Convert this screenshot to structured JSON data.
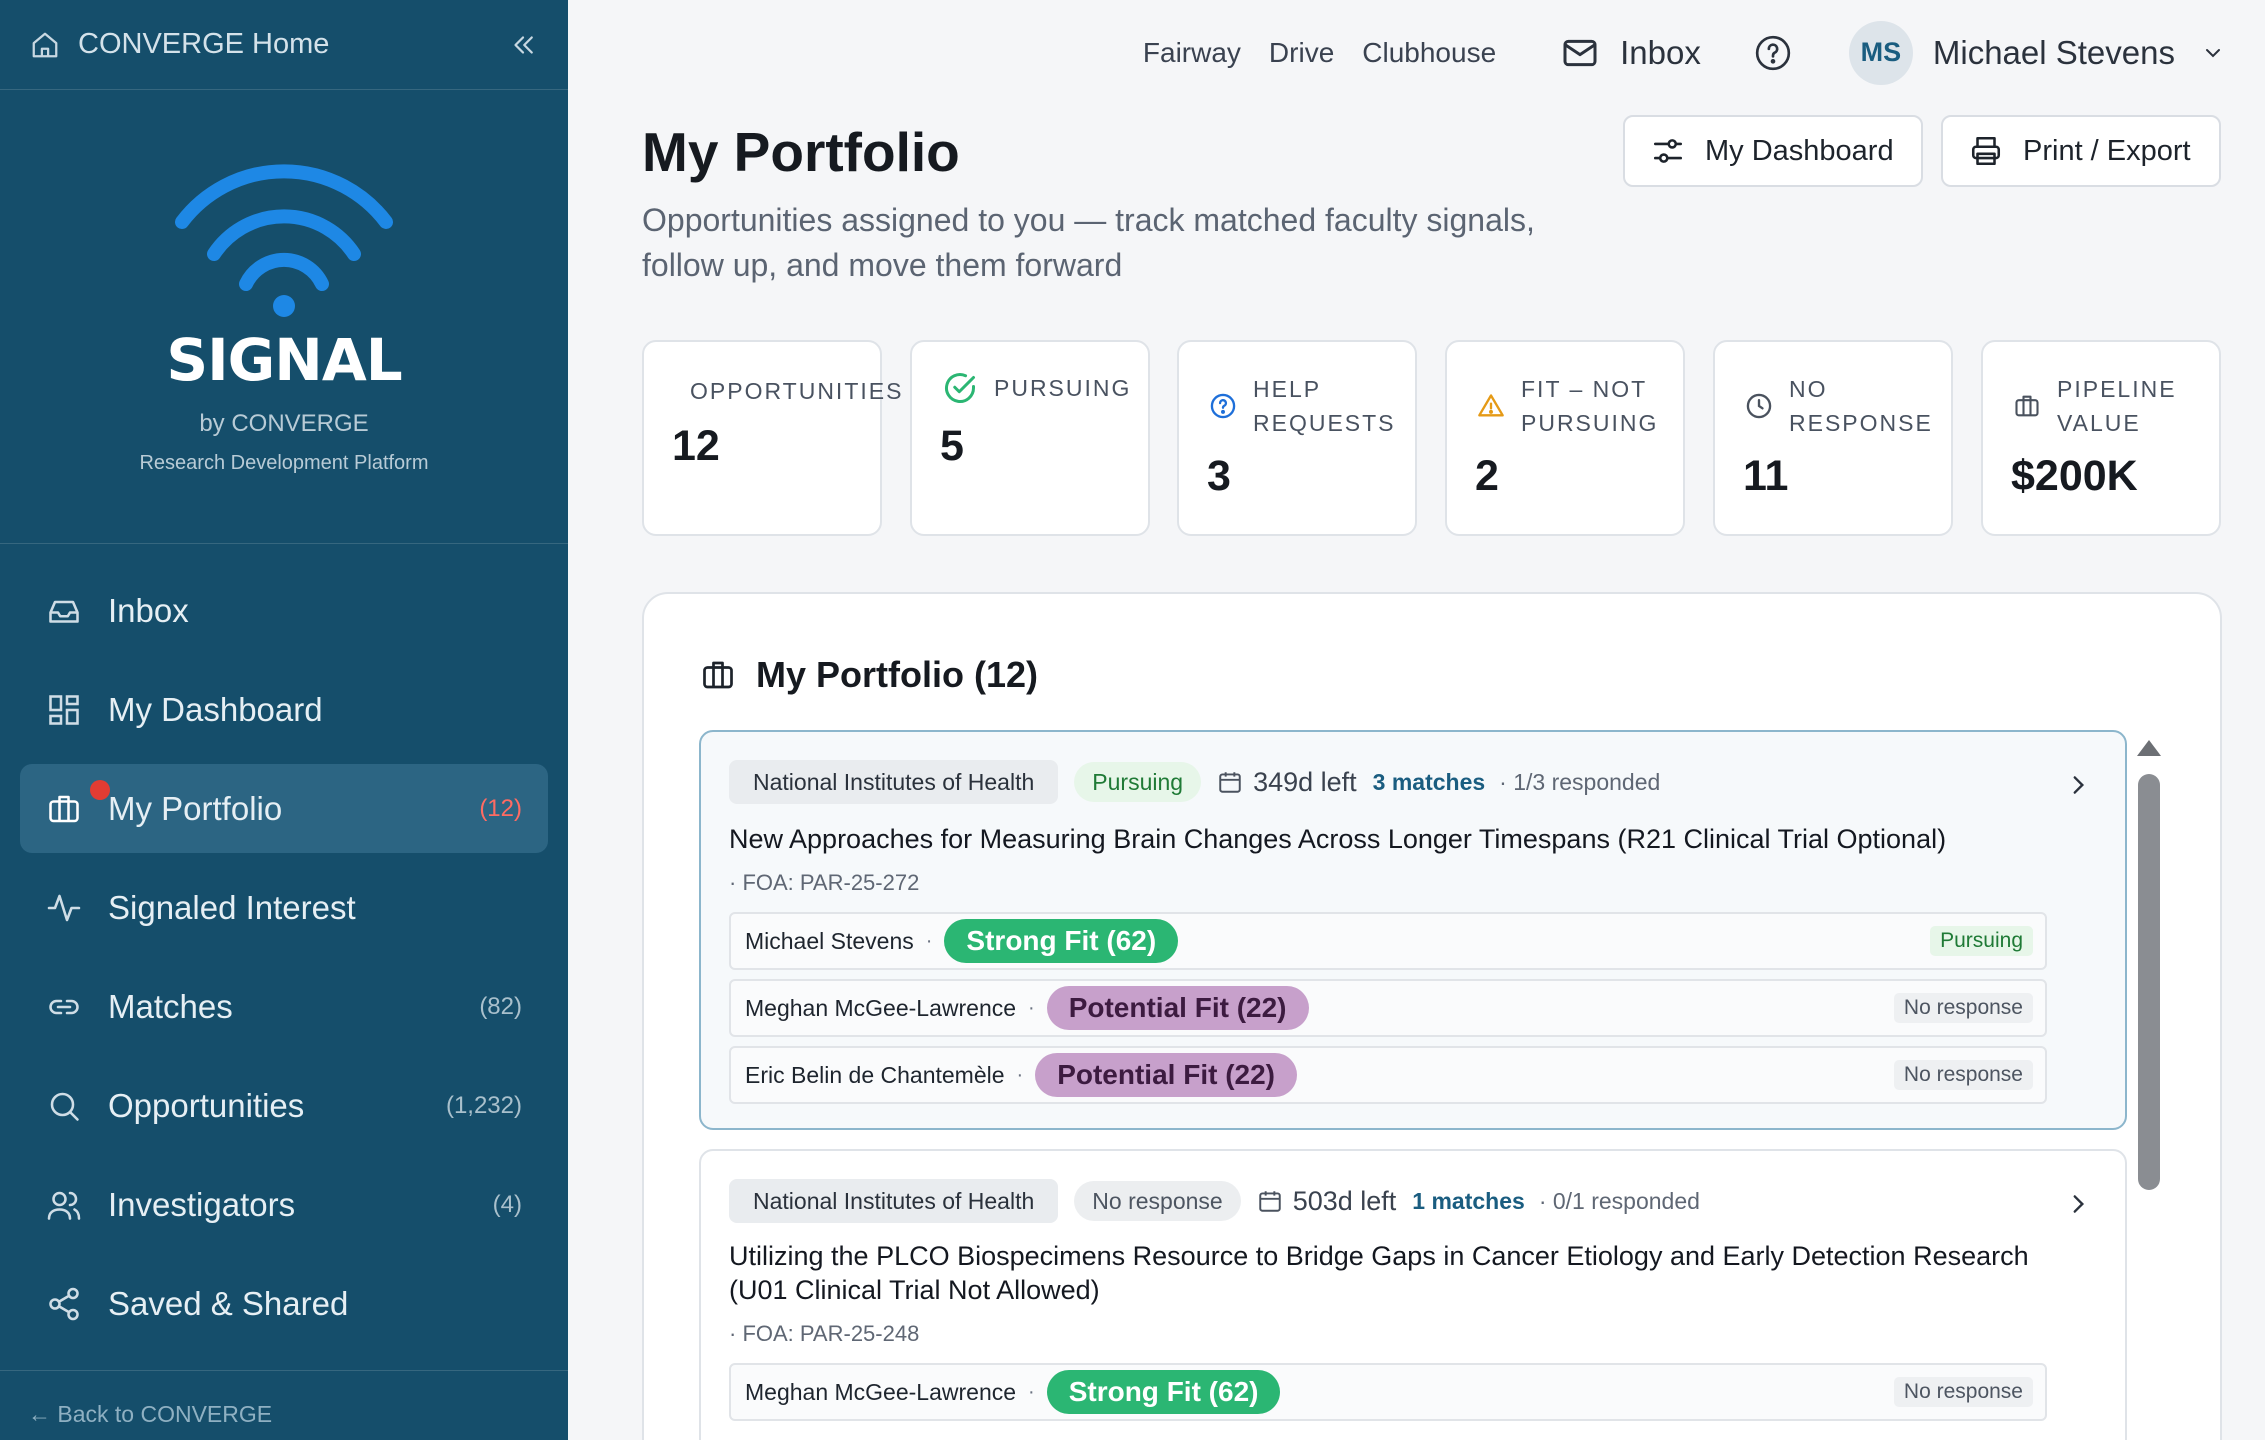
{
  "sidebar": {
    "home_label": "CONVERGE Home",
    "brand_name": "SIGNAL",
    "brand_by": "by CONVERGE",
    "brand_platform": "Research Development Platform",
    "back_link": "← Back to CONVERGE",
    "items": [
      {
        "label": "Inbox",
        "count": "",
        "icon": "inbox-tray-icon"
      },
      {
        "label": "My Dashboard",
        "count": "",
        "icon": "dashboard-grid-icon"
      },
      {
        "label": "My Portfolio",
        "count": "(12)",
        "icon": "briefcase-icon"
      },
      {
        "label": "Signaled Interest",
        "count": "",
        "icon": "activity-pulse-icon"
      },
      {
        "label": "Matches",
        "count": "(82)",
        "icon": "link-icon"
      },
      {
        "label": "Opportunities",
        "count": "(1,232)",
        "icon": "search-icon"
      },
      {
        "label": "Investigators",
        "count": "(4)",
        "icon": "users-icon"
      },
      {
        "label": "Saved & Shared",
        "count": "",
        "icon": "share-icon"
      }
    ]
  },
  "topbar": {
    "links": [
      "Fairway",
      "Drive",
      "Clubhouse"
    ],
    "inbox_label": "Inbox",
    "user_initials": "MS",
    "user_name": "Michael Stevens"
  },
  "header": {
    "title": "My Portfolio",
    "subtitle": "Opportunities assigned to you — track matched faculty signals, follow up, and move them forward",
    "dashboard_button": "My Dashboard",
    "print_button": "Print / Export"
  },
  "stats": [
    {
      "label": "OPPORTUNITIES",
      "value": "12",
      "icon": ""
    },
    {
      "label": "PURSUING",
      "value": "5",
      "icon": "check-circle-icon"
    },
    {
      "label": "HELP REQUESTS",
      "value": "3",
      "icon": "help-circle-icon"
    },
    {
      "label": "FIT – NOT PURSUING",
      "value": "2",
      "icon": "warning-triangle-icon"
    },
    {
      "label": "NO RESPONSE",
      "value": "11",
      "icon": "clock-icon"
    },
    {
      "label": "PIPELINE VALUE",
      "value": "$200K",
      "icon": "briefcase-icon"
    }
  ],
  "portfolio": {
    "title": "My Portfolio (12)",
    "cards": [
      {
        "agency": "National Institutes of Health",
        "status": "Pursuing",
        "days_left": "349d left",
        "matches": "3 matches",
        "responded": "· 1/3 responded",
        "title": "New Approaches for Measuring Brain Changes Across Longer Timespans (R21 Clinical Trial Optional)",
        "foa": "· FOA: PAR-25-272",
        "rows": [
          {
            "name": "Michael Stevens",
            "fit": "Strong Fit (62)",
            "status": "Pursuing"
          },
          {
            "name": "Meghan McGee-Lawrence",
            "fit": "Potential Fit (22)",
            "status": "No response"
          },
          {
            "name": "Eric Belin de Chantemèle",
            "fit": "Potential Fit (22)",
            "status": "No response"
          }
        ]
      },
      {
        "agency": "National Institutes of Health",
        "status": "No response",
        "days_left": "503d left",
        "matches": "1 matches",
        "responded": "· 0/1 responded",
        "title": "Utilizing the PLCO Biospecimens Resource to Bridge Gaps in Cancer Etiology and Early Detection Research (U01 Clinical Trial Not Allowed)",
        "foa": "· FOA: PAR-25-248",
        "rows": [
          {
            "name": "Meghan McGee-Lawrence",
            "fit": "Strong Fit (62)",
            "status": "No response"
          }
        ]
      }
    ]
  },
  "colors": {
    "sidebar_bg": "#154e6b",
    "active_nav_bg": "#2c6583",
    "strong_fit": "#2bb673",
    "potential_fit": "#c7a0cb",
    "accent": "#1a5d80",
    "wifi_blue": "#1e88e5"
  }
}
